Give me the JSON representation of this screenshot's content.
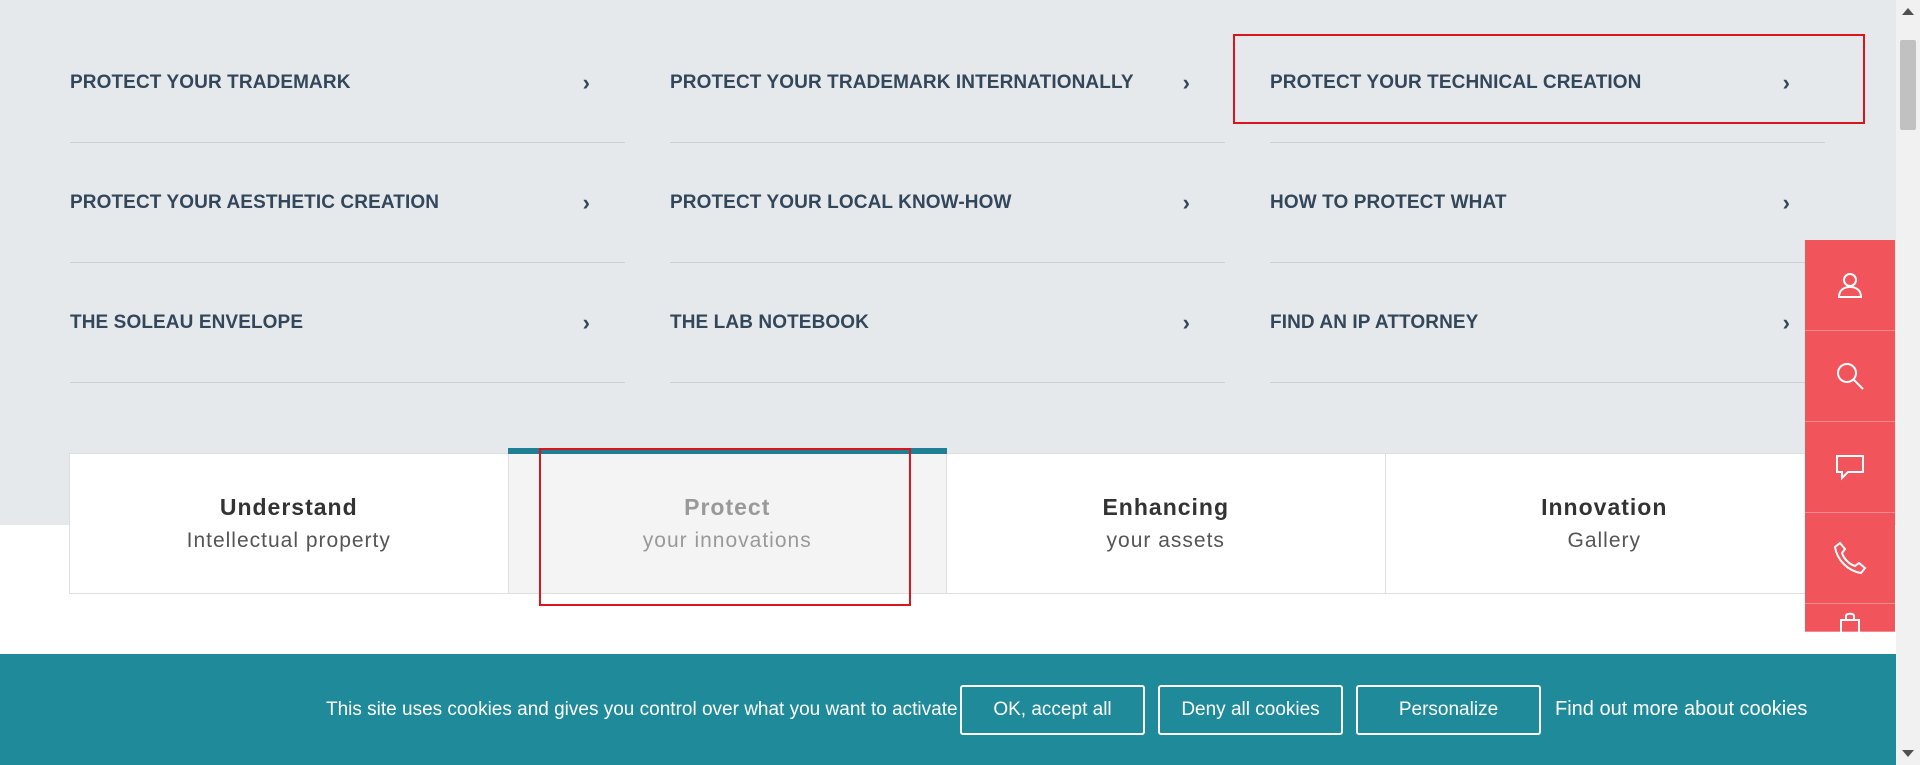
{
  "links": {
    "col1": [
      {
        "label": "PROTECT YOUR TRADEMARK",
        "chev": "›"
      },
      {
        "label": "PROTECT YOUR AESTHETIC CREATION",
        "chev": "›"
      },
      {
        "label": "THE SOLEAU ENVELOPE",
        "chev": "›"
      }
    ],
    "col2": [
      {
        "label": "PROTECT YOUR TRADEMARK INTERNATIONALLY",
        "chev": "›"
      },
      {
        "label": "PROTECT YOUR LOCAL KNOW-HOW",
        "chev": "›"
      },
      {
        "label": "THE LAB NOTEBOOK",
        "chev": "›"
      }
    ],
    "col3": [
      {
        "label": "PROTECT YOUR TECHNICAL CREATION",
        "chev": "›"
      },
      {
        "label": "HOW TO PROTECT WHAT",
        "chev": "›"
      },
      {
        "label": "FIND AN IP ATTORNEY",
        "chev": "›"
      }
    ]
  },
  "tabs": [
    {
      "title": "Understand",
      "subtitle": "Intellectual property"
    },
    {
      "title": "Protect",
      "subtitle": "your innovations"
    },
    {
      "title": "Enhancing",
      "subtitle": "your assets"
    },
    {
      "title": "Innovation",
      "subtitle": "Gallery"
    }
  ],
  "side_buttons": [
    "user-icon",
    "search-icon",
    "chat-icon",
    "phone-icon",
    "bag-icon"
  ],
  "cookie": {
    "text": "This site uses cookies and gives you control over what you want to activate",
    "accept_all": "OK, accept all",
    "deny_all": "Deny all cookies",
    "personalize": "Personalize",
    "find_out_more": "Find out more about cookies"
  },
  "colors": {
    "accent_teal": "#1f8a99",
    "side_red": "#f2545b",
    "highlight_red": "#d9161c"
  }
}
